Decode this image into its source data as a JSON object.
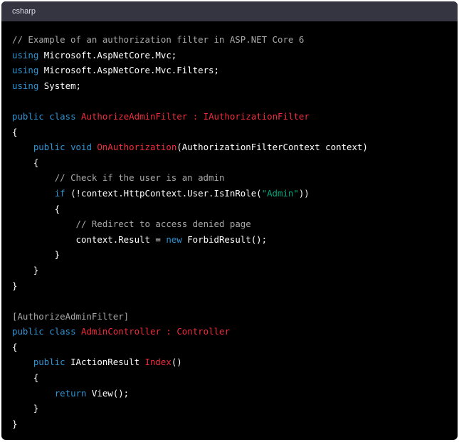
{
  "header": {
    "language": "csharp"
  },
  "colors": {
    "panel_bg": "#000000",
    "header_bg": "#343541",
    "comment": "#a9a9a9",
    "keyword": "#2e95d3",
    "class_name": "#f22c3d",
    "string": "#00a67d",
    "plain": "#ffffff"
  },
  "code": {
    "lines": [
      [
        {
          "t": "comment",
          "v": "// Example of an authorization filter in ASP.NET Core 6"
        }
      ],
      [
        {
          "t": "keyword",
          "v": "using"
        },
        {
          "t": "plain",
          "v": " Microsoft.AspNetCore.Mvc;"
        }
      ],
      [
        {
          "t": "keyword",
          "v": "using"
        },
        {
          "t": "plain",
          "v": " Microsoft.AspNetCore.Mvc.Filters;"
        }
      ],
      [
        {
          "t": "keyword",
          "v": "using"
        },
        {
          "t": "plain",
          "v": " System;"
        }
      ],
      [],
      [
        {
          "t": "keyword",
          "v": "public"
        },
        {
          "t": "plain",
          "v": " "
        },
        {
          "t": "keyword",
          "v": "class"
        },
        {
          "t": "plain",
          "v": " "
        },
        {
          "t": "class",
          "v": "AuthorizeAdminFilter"
        },
        {
          "t": "plain",
          "v": " "
        },
        {
          "t": "class",
          "v": ":"
        },
        {
          "t": "plain",
          "v": " "
        },
        {
          "t": "class",
          "v": "IAuthorizationFilter"
        }
      ],
      [
        {
          "t": "plain",
          "v": "{"
        }
      ],
      [
        {
          "t": "plain",
          "v": "    "
        },
        {
          "t": "keyword",
          "v": "public"
        },
        {
          "t": "plain",
          "v": " "
        },
        {
          "t": "keyword",
          "v": "void"
        },
        {
          "t": "plain",
          "v": " "
        },
        {
          "t": "class",
          "v": "OnAuthorization"
        },
        {
          "t": "plain",
          "v": "(AuthorizationFilterContext context)"
        }
      ],
      [
        {
          "t": "plain",
          "v": "    {"
        }
      ],
      [
        {
          "t": "plain",
          "v": "        "
        },
        {
          "t": "comment",
          "v": "// Check if the user is an admin"
        }
      ],
      [
        {
          "t": "plain",
          "v": "        "
        },
        {
          "t": "keyword",
          "v": "if"
        },
        {
          "t": "plain",
          "v": " (!context.HttpContext.User.IsInRole("
        },
        {
          "t": "string",
          "v": "\"Admin\""
        },
        {
          "t": "plain",
          "v": "))"
        }
      ],
      [
        {
          "t": "plain",
          "v": "        {"
        }
      ],
      [
        {
          "t": "plain",
          "v": "            "
        },
        {
          "t": "comment",
          "v": "// Redirect to access denied page"
        }
      ],
      [
        {
          "t": "plain",
          "v": "            context.Result = "
        },
        {
          "t": "keyword",
          "v": "new"
        },
        {
          "t": "plain",
          "v": " ForbidResult();"
        }
      ],
      [
        {
          "t": "plain",
          "v": "        }"
        }
      ],
      [
        {
          "t": "plain",
          "v": "    }"
        }
      ],
      [
        {
          "t": "plain",
          "v": "}"
        }
      ],
      [],
      [
        {
          "t": "attr",
          "v": "[AuthorizeAdminFilter]"
        }
      ],
      [
        {
          "t": "keyword",
          "v": "public"
        },
        {
          "t": "plain",
          "v": " "
        },
        {
          "t": "keyword",
          "v": "class"
        },
        {
          "t": "plain",
          "v": " "
        },
        {
          "t": "class",
          "v": "AdminController"
        },
        {
          "t": "plain",
          "v": " "
        },
        {
          "t": "class",
          "v": ":"
        },
        {
          "t": "plain",
          "v": " "
        },
        {
          "t": "class",
          "v": "Controller"
        }
      ],
      [
        {
          "t": "plain",
          "v": "{"
        }
      ],
      [
        {
          "t": "plain",
          "v": "    "
        },
        {
          "t": "keyword",
          "v": "public"
        },
        {
          "t": "plain",
          "v": " IActionResult "
        },
        {
          "t": "class",
          "v": "Index"
        },
        {
          "t": "plain",
          "v": "()"
        }
      ],
      [
        {
          "t": "plain",
          "v": "    {"
        }
      ],
      [
        {
          "t": "plain",
          "v": "        "
        },
        {
          "t": "keyword",
          "v": "return"
        },
        {
          "t": "plain",
          "v": " View();"
        }
      ],
      [
        {
          "t": "plain",
          "v": "    }"
        }
      ],
      [
        {
          "t": "plain",
          "v": "}"
        }
      ]
    ]
  }
}
